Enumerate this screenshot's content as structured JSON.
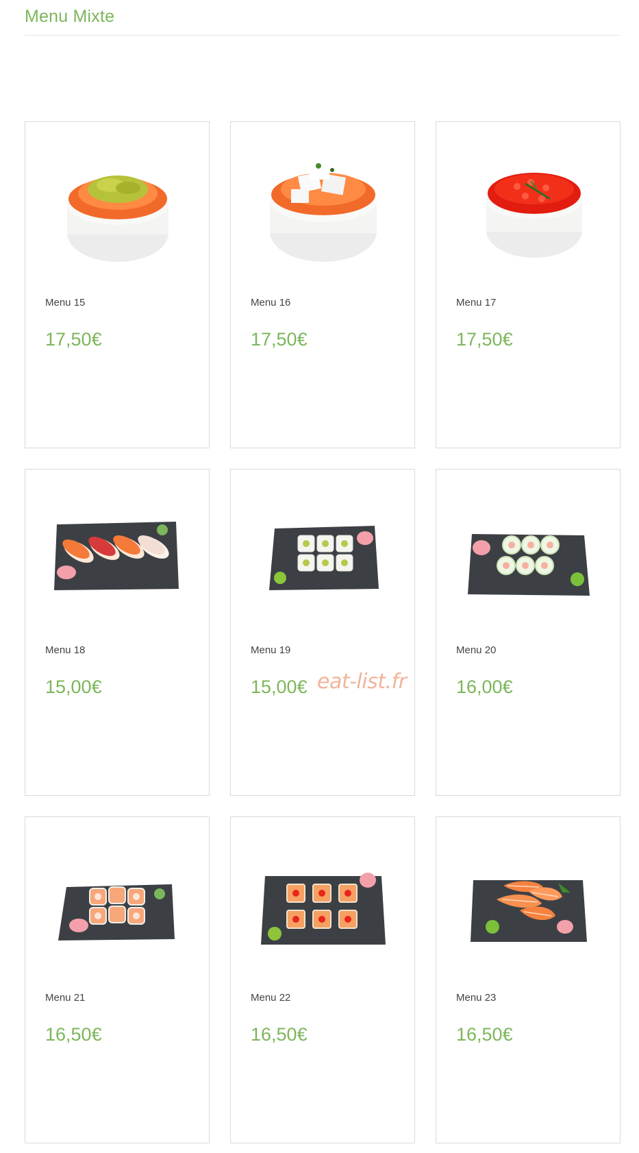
{
  "section": {
    "title": "Menu Mixte"
  },
  "colors": {
    "accent": "#7cb65a",
    "border": "#d9d9d9",
    "slate": "#3c4045",
    "watermark": "#f0b49a"
  },
  "watermark": "eat-list.fr",
  "items": [
    {
      "name": "Menu 15",
      "price": "17,50€",
      "image": "chirashi-avocado-salmon-icon"
    },
    {
      "name": "Menu 16",
      "price": "17,50€",
      "image": "chirashi-cheese-salmon-icon"
    },
    {
      "name": "Menu 17",
      "price": "17,50€",
      "image": "chirashi-salmon-roe-icon"
    },
    {
      "name": "Menu 18",
      "price": "15,00€",
      "image": "nigiri-platter-icon"
    },
    {
      "name": "Menu 19",
      "price": "15,00€",
      "image": "california-rolls-platter-icon"
    },
    {
      "name": "Menu 20",
      "price": "16,00€",
      "image": "spring-rolls-platter-icon"
    },
    {
      "name": "Menu 21",
      "price": "16,50€",
      "image": "salmon-rolls-platter-icon"
    },
    {
      "name": "Menu 22",
      "price": "16,50€",
      "image": "maki-roe-platter-icon"
    },
    {
      "name": "Menu 23",
      "price": "16,50€",
      "image": "sashimi-platter-icon"
    }
  ]
}
